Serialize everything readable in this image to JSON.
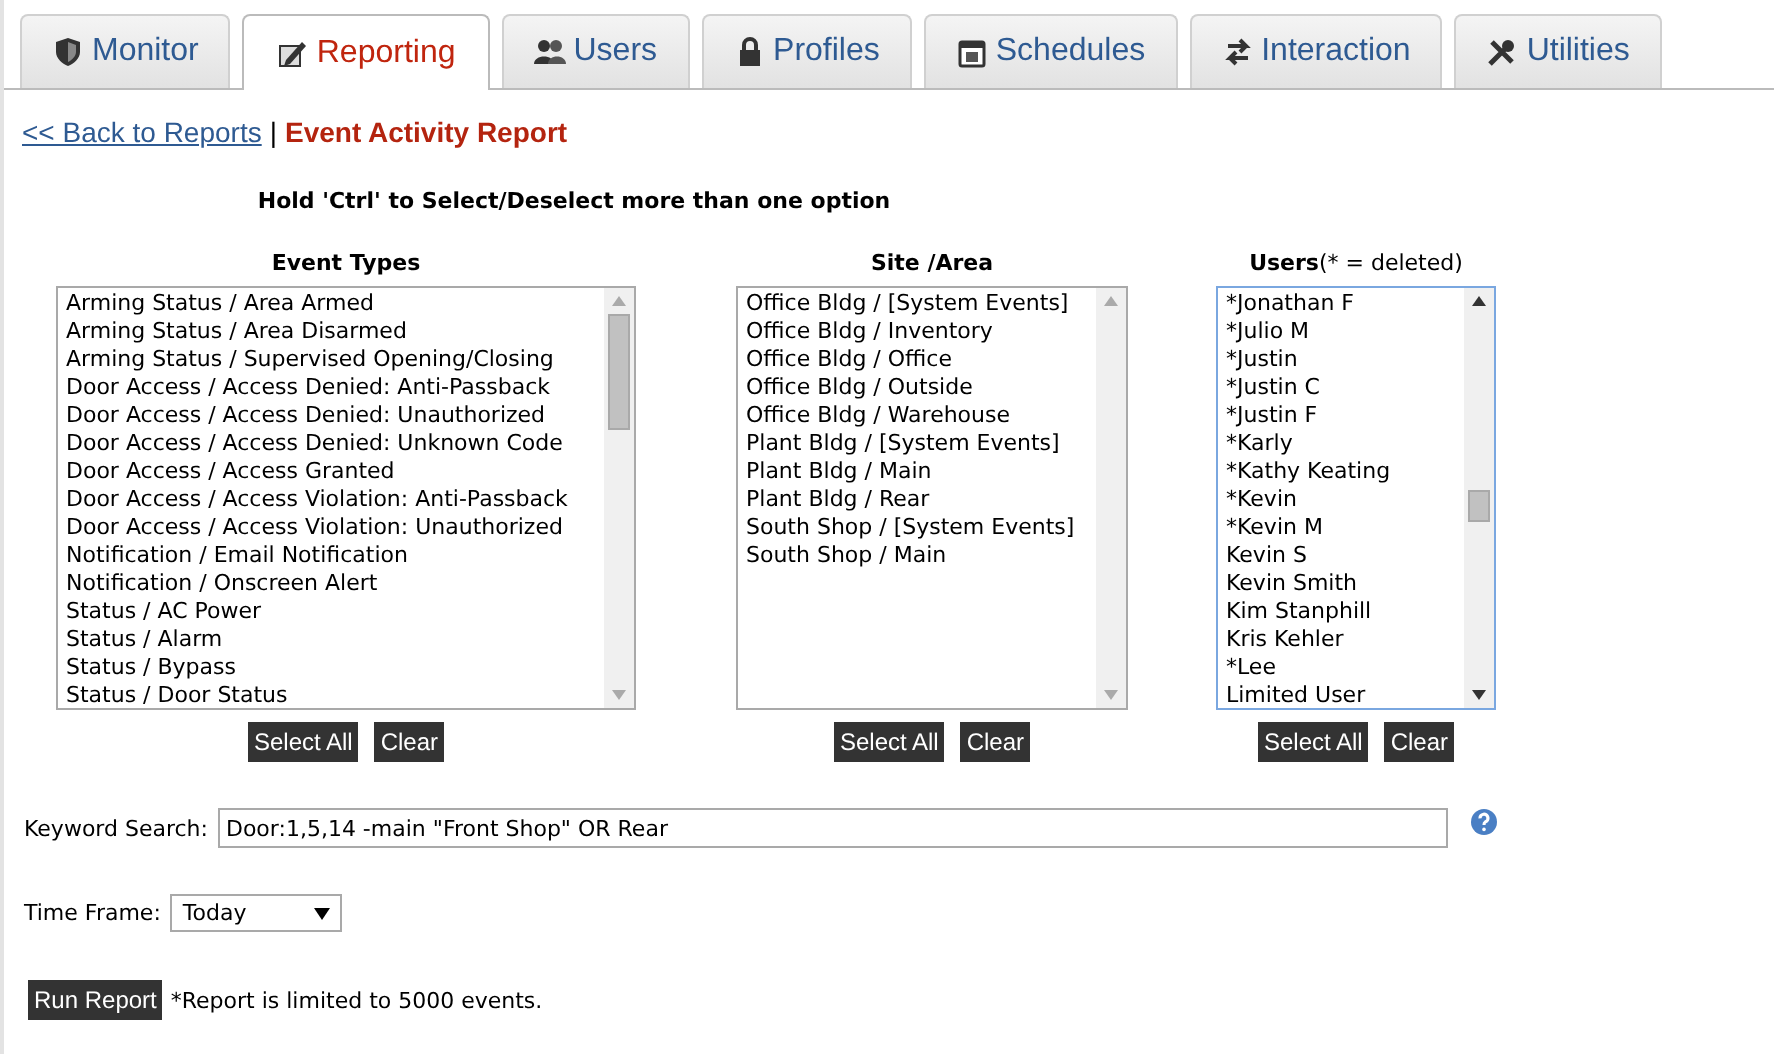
{
  "tabs": [
    {
      "label": "Monitor",
      "selected": false
    },
    {
      "label": "Reporting",
      "selected": true
    },
    {
      "label": "Users",
      "selected": false
    },
    {
      "label": "Profiles",
      "selected": false
    },
    {
      "label": "Schedules",
      "selected": false
    },
    {
      "label": "Interaction",
      "selected": false
    },
    {
      "label": "Utilities",
      "selected": false
    }
  ],
  "breadcrumb": {
    "back_link": "<< Back to Reports",
    "separator": "|",
    "title": "Event Activity Report"
  },
  "hint": "Hold 'Ctrl' to Select/Deselect more than one option",
  "lists": [
    {
      "heading": "Event Types",
      "focused": false,
      "items": [
        "Arming Status / Area Armed",
        "Arming Status / Area Disarmed",
        "Arming Status / Supervised Opening/Closing",
        "Door Access / Access Denied: Anti-Passback",
        "Door Access / Access Denied: Unauthorized",
        "Door Access / Access Denied: Unknown Code",
        "Door Access / Access Granted",
        "Door Access / Access Violation: Anti-Passback",
        "Door Access / Access Violation: Unauthorized",
        "Notification / Email Notification",
        "Notification / Onscreen Alert",
        "Status / AC Power",
        "Status / Alarm",
        "Status / Bypass",
        "Status / Door Status"
      ],
      "buttons": [
        "Select All",
        "Clear"
      ]
    },
    {
      "heading": "Site /Area",
      "focused": false,
      "items": [
        "Office Bldg / [System Events]",
        "Office Bldg / Inventory",
        "Office Bldg / Office",
        "Office Bldg / Outside",
        "Office Bldg / Warehouse",
        "Plant Bldg / [System Events]",
        "Plant Bldg / Main",
        "Plant Bldg / Rear",
        "South Shop / [System Events]",
        "South Shop / Main"
      ],
      "buttons": [
        "Select All",
        "Clear"
      ]
    },
    {
      "heading": "**Users**(* = deleted)",
      "focused": true,
      "items": [
        "*Jonathan F",
        "*Julio M",
        "*Justin",
        "*Justin C",
        "*Justin F",
        "*Karly",
        "*Kathy Keating",
        "*Kevin",
        "*Kevin M",
        "Kevin S",
        "Kevin Smith",
        "Kim Stanphill",
        "Kris Kehler",
        "*Lee",
        "Limited User"
      ],
      "buttons": [
        "Select All",
        "Clear"
      ]
    }
  ],
  "keyword_search": {
    "label": "Keyword Search:",
    "value": "Door:1,5,14 -main \"Front Shop\" OR Rear"
  },
  "time_frame": {
    "label": "Time Frame:",
    "value": "Today"
  },
  "run_button": "Run Report",
  "note": "*Report is limited to 5000 events."
}
